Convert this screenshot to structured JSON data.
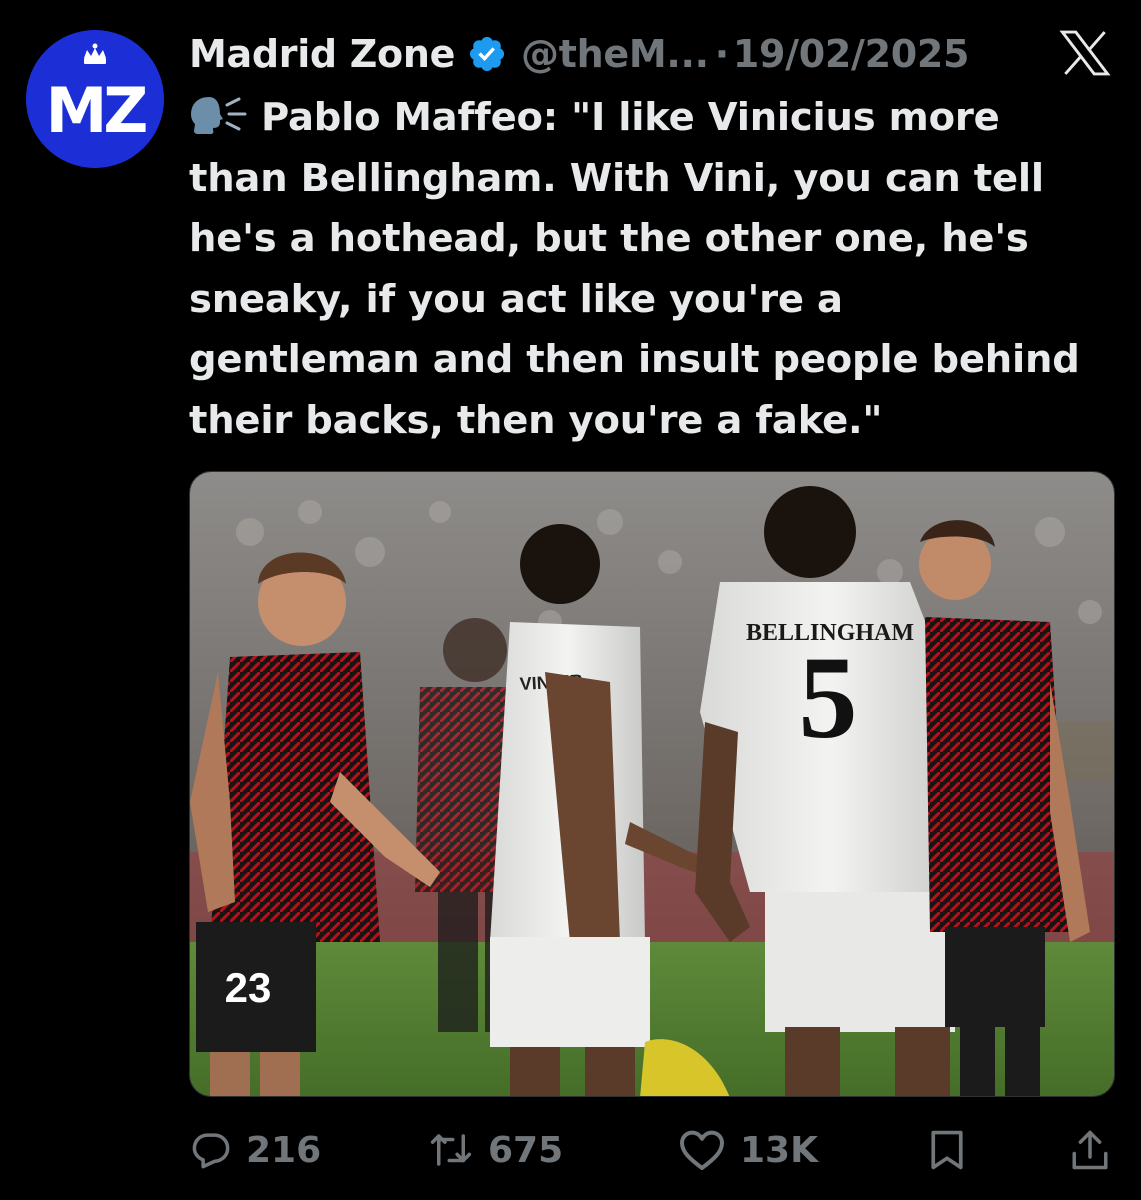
{
  "account": {
    "display_name": "Madrid Zone",
    "handle": "@theM...",
    "separator": "·",
    "date": "19/02/2025",
    "avatar_text": "MZ"
  },
  "tweet": {
    "lines": [
      "Pablo Maffeo: \"I like Vinicius more",
      "than Bellingham. With Vini, you can tell",
      "he's a hothead, but the other one, he's",
      "sneaky, if you act like you're a",
      "gentleman and then insult people behind",
      "their backs, then you're a fake.\""
    ]
  },
  "media": {
    "jersey_name": "BELLINGHAM",
    "jersey_number": "5",
    "shorts_number": "23",
    "vini_name": "VINI JR"
  },
  "metrics": {
    "replies": "216",
    "reposts": "675",
    "likes": "13K"
  },
  "icons": {
    "verified": "verified-badge-icon",
    "x_logo": "x-logo-icon",
    "speaking": "speaking-head-icon",
    "reply": "reply-icon",
    "repost": "repost-icon",
    "like": "heart-icon",
    "bookmark": "bookmark-icon",
    "share": "share-icon"
  },
  "colors": {
    "background": "#000000",
    "text": "#e7e9ea",
    "muted": "#71767b",
    "verified": "#1d9bf0",
    "avatar": "#1c2fd6"
  }
}
